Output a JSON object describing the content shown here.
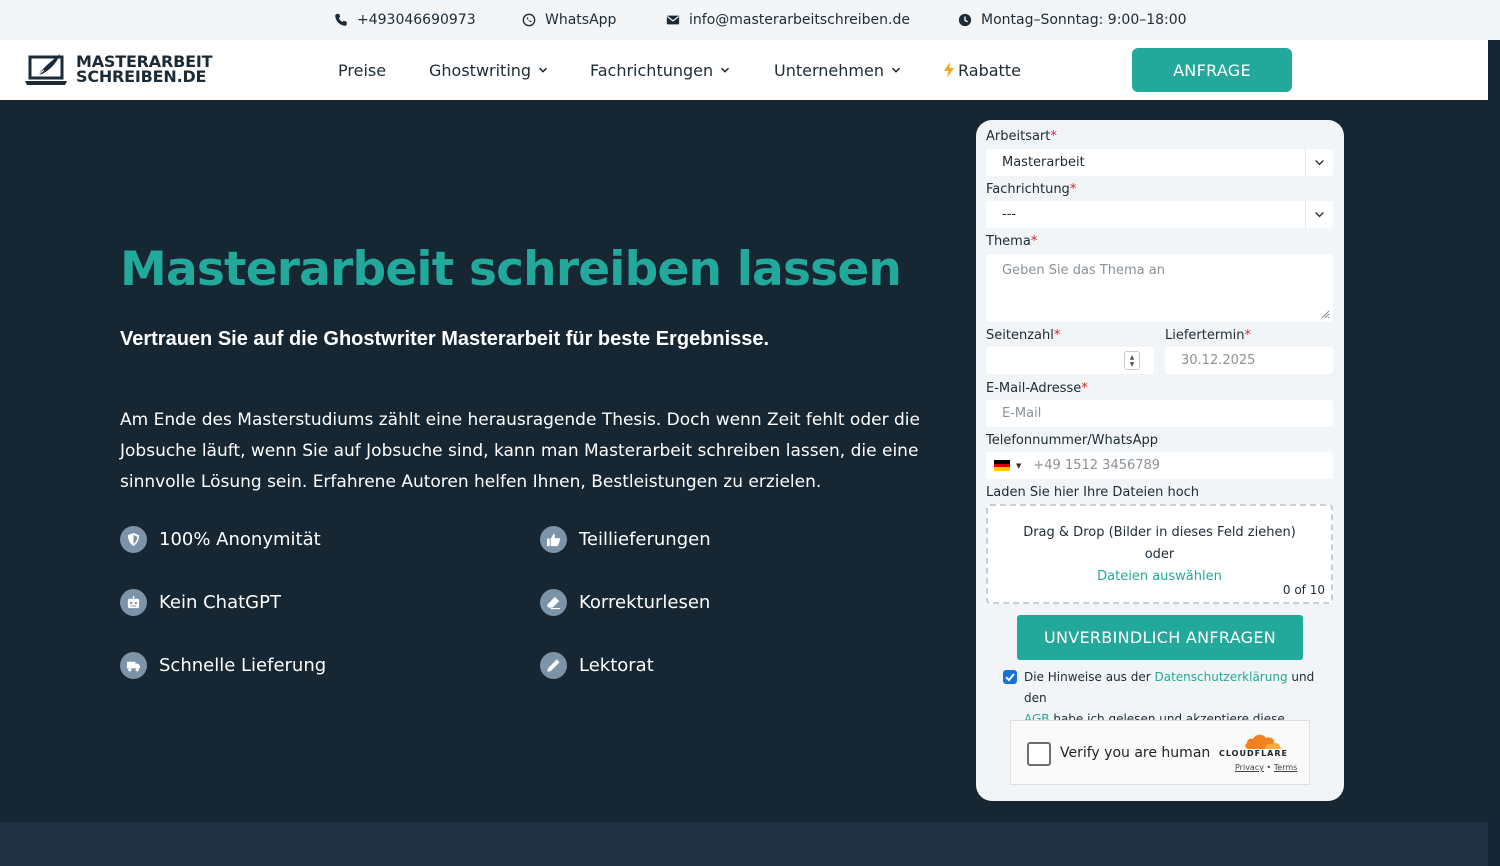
{
  "topbar": {
    "phone": "+493046690973",
    "whatsapp": "WhatsApp",
    "email": "info@masterarbeitschreiben.de",
    "hours": "Montag–Sonntag: 9:00–18:00"
  },
  "logo": {
    "line1": "MASTERARBEIT",
    "line2": "SCHREIBEN.DE"
  },
  "nav": {
    "items": [
      {
        "label": "Preise"
      },
      {
        "label": "Ghostwriting"
      },
      {
        "label": "Fachrichtungen"
      },
      {
        "label": "Unternehmen"
      },
      {
        "label": "Rabatte",
        "prefix_icon": "lightning-icon"
      }
    ],
    "cta": "ANFRAGE"
  },
  "hero": {
    "title": "Masterarbeit schreiben lassen",
    "subtitle": "Vertrauen Sie auf die Ghostwriter Masterarbeit für beste Ergebnisse.",
    "text": "Am Ende des Masterstudiums zählt eine herausragende Thesis. Doch wenn Zeit fehlt oder die Jobsuche läuft, wenn Sie auf Jobsuche sind, kann man Masterarbeit schreiben lassen, die eine sinnvolle Lösung sein. Erfahrene Autoren helfen Ihnen, Bestleistungen zu erzielen.",
    "features": [
      {
        "label": "100% Anonymität",
        "icon": "shield-icon"
      },
      {
        "label": "Teillieferungen",
        "icon": "thumbs-up-icon"
      },
      {
        "label": "Kein ChatGPT",
        "icon": "robot-icon"
      },
      {
        "label": "Korrekturlesen",
        "icon": "eraser-icon"
      },
      {
        "label": "Schnelle Lieferung",
        "icon": "truck-icon"
      },
      {
        "label": "Lektorat",
        "icon": "pencil-icon"
      }
    ]
  },
  "form": {
    "arbeitsart": {
      "label": "Arbeitsart",
      "value": "Masterarbeit"
    },
    "fachrichtung": {
      "label": "Fachrichtung",
      "value": "---"
    },
    "thema": {
      "label": "Thema",
      "placeholder": "Geben Sie das Thema an"
    },
    "seitenzahl": {
      "label": "Seitenzahl",
      "value": ""
    },
    "liefertermin": {
      "label": "Liefertermin",
      "placeholder": "30.12.2025"
    },
    "email": {
      "label": "E-Mail-Adresse",
      "placeholder": "E-Mail"
    },
    "telefon": {
      "label": "Telefonnummer/WhatsApp",
      "placeholder": "+49 1512 3456789"
    },
    "upload": {
      "label": "Laden Sie hier Ihre Dateien hoch",
      "line1": "Drag & Drop (Bilder in dieses Feld ziehen)",
      "line2": "oder",
      "link": "Dateien auswählen",
      "count": "0 of 10"
    },
    "submit": "UNVERBINDLICH ANFRAGEN",
    "consent": {
      "part1": "Die Hinweise aus der ",
      "link1": "Datenschutzerklärung",
      "part2": " und den ",
      "link2": "AGB",
      "part3": " habe ich gelesen und akzeptiere diese.",
      "checked": true
    },
    "captcha": {
      "text": "Verify you are human",
      "brand": "CLOUDFLARE",
      "privacy": "Privacy",
      "sep": " • ",
      "terms": "Terms"
    }
  },
  "colors": {
    "accent": "#23a99b",
    "dark_bg": "#172633",
    "required": "#e0242f",
    "checkbox": "#1673d6"
  }
}
